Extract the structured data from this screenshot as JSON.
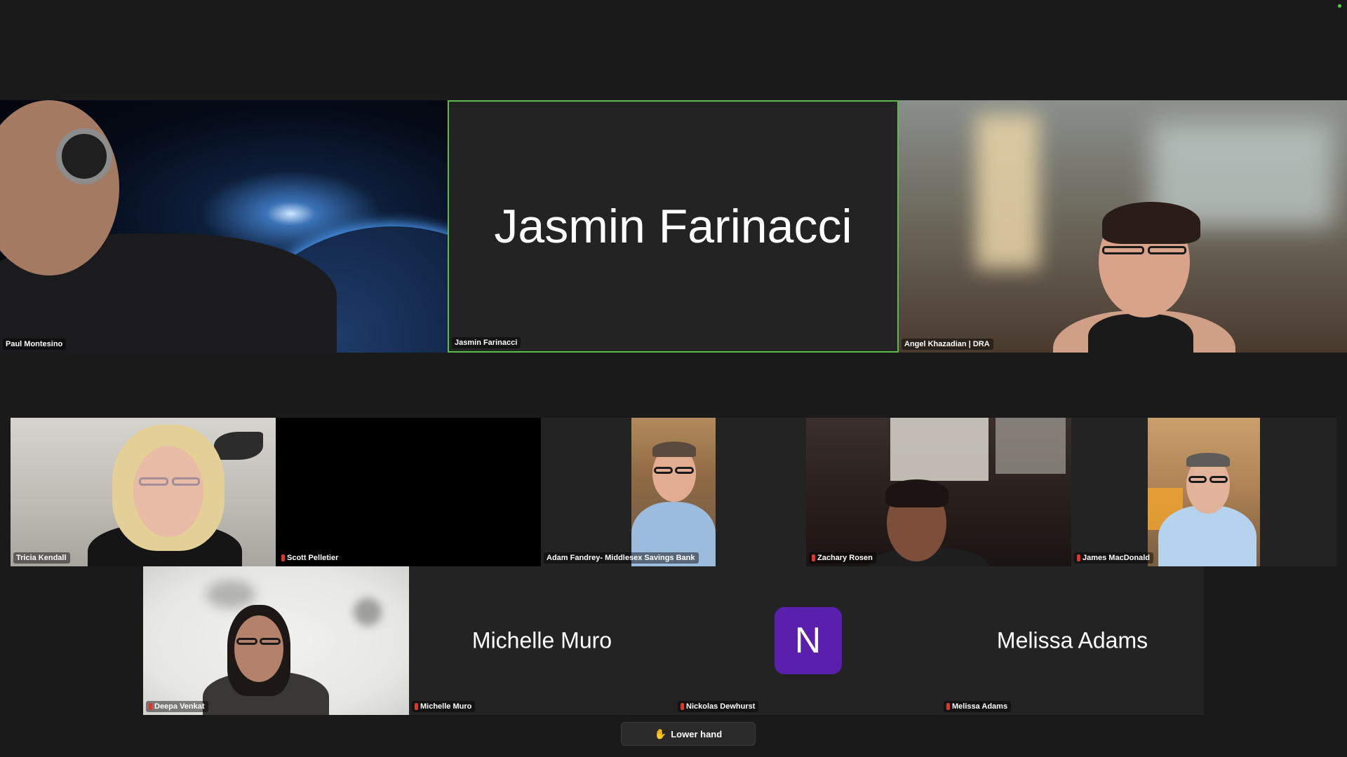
{
  "top_row": {
    "paul": {
      "label": "Paul Montesino"
    },
    "jasmin": {
      "label": "Jasmin Farinacci",
      "display_name": "Jasmin Farinacci"
    },
    "angel": {
      "label": "Angel Khazadian | DRA"
    }
  },
  "middle_row": {
    "tricia": {
      "label": "Tricia Kendall"
    },
    "scott": {
      "label": "Scott Pelletier"
    },
    "adam": {
      "label": "Adam Fandrey- Middlesex Savings Bank"
    },
    "zachary": {
      "label": "Zachary Rosen"
    },
    "james": {
      "label": "James MacDonald"
    }
  },
  "bottom_row": {
    "deepa": {
      "label": "Deepa Venkat"
    },
    "michelle": {
      "label": "Michelle Muro",
      "display_name": "Michelle Muro"
    },
    "nickolas": {
      "label": "Nickolas Dewhurst",
      "avatar_letter": "N"
    },
    "melissa": {
      "label": "Melissa Adams",
      "display_name": "Melissa Adams"
    }
  },
  "controls": {
    "lower_hand_label": "Lower hand",
    "hand_icon": "✋"
  },
  "colors": {
    "active_speaker_border": "#5dbb4e",
    "avatar_bg": "#5b1fae",
    "mic_muted": "#e0342f"
  }
}
